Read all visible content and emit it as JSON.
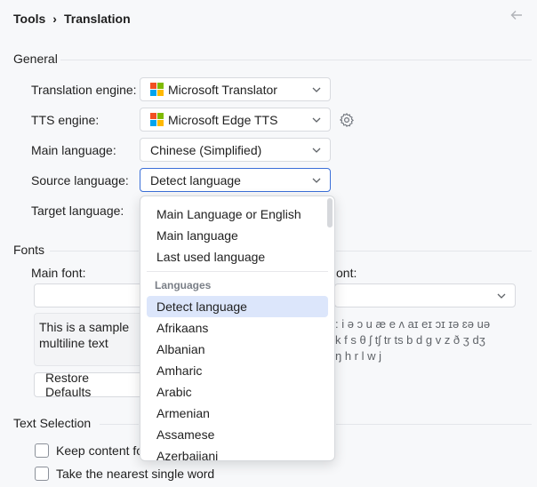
{
  "breadcrumb": {
    "parent": "Tools",
    "separator": "›",
    "current": "Translation"
  },
  "icons": {
    "back": "arrow-left-icon",
    "chevron": "chevron-down-icon",
    "gear": "gear-icon",
    "microsoft": "microsoft-logo-icon"
  },
  "colors": {
    "accent": "#3b6fd8",
    "selected_bg": "#dce6fb",
    "ms_red": "#f25022",
    "ms_green": "#7fba00",
    "ms_blue": "#00a4ef",
    "ms_yellow": "#ffb900"
  },
  "general": {
    "title": "General",
    "translation_engine": {
      "label": "Translation engine:",
      "value": "Microsoft Translator"
    },
    "tts_engine": {
      "label": "TTS engine:",
      "value": "Microsoft Edge TTS"
    },
    "main_language": {
      "label": "Main language:",
      "value": "Chinese (Simplified)"
    },
    "source_language": {
      "label": "Source language:",
      "value": "Detect language"
    },
    "target_language": {
      "label": "Target language:"
    }
  },
  "fonts": {
    "title": "Fonts",
    "main_font_label": "Main font:",
    "phonetic_font_label_partial": "ont:",
    "sample_text_line1": "This is a sample",
    "sample_text_line2": "multiline text",
    "ipa_line1": ": i ə ɔ u æ e ʌ aɪ eɪ ɔɪ ɪə ɛə uə",
    "ipa_line2": "k f s θ ʃ tʃ tr ts b d g v z ð ʒ dʒ",
    "ipa_line3": "ŋ h r l w j",
    "restore_defaults_label": "Restore Defaults"
  },
  "text_selection": {
    "title": "Text Selection",
    "keep_content_label": "Keep content fo",
    "nearest_word_label": "Take the nearest single word"
  },
  "dropdown": {
    "special_items": [
      "Main Language or English",
      "Main language",
      "Last used language"
    ],
    "group_label": "Languages",
    "languages": [
      "Detect language",
      "Afrikaans",
      "Albanian",
      "Amharic",
      "Arabic",
      "Armenian",
      "Assamese",
      "Azerbaijani"
    ],
    "selected": "Detect language"
  }
}
